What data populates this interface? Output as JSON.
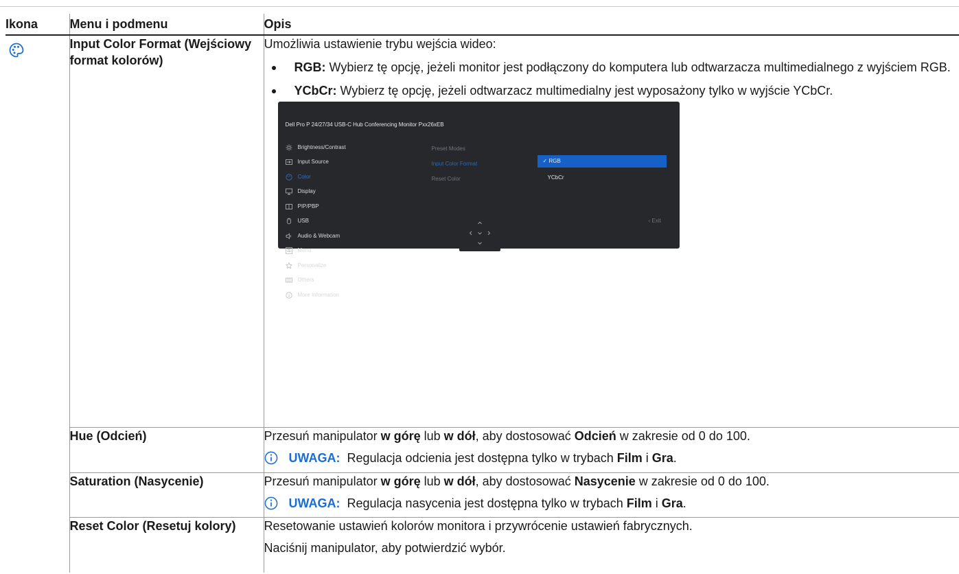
{
  "header": {
    "col_icon": "Ikona",
    "col_menu": "Menu i podmenu",
    "col_desc": "Opis"
  },
  "icon": "color-palette-icon",
  "rows": {
    "input_color": {
      "menu": "Input Color Format (Wejściowy format kolorów)",
      "intro": "Umożliwia ustawienie trybu wejścia wideo:",
      "bullet1_term": "RGB:",
      "bullet1_text": " Wybierz tę opcję, jeżeli monitor jest podłączony do komputera lub odtwarzacza multimedialnego z wyjściem RGB.",
      "bullet2_term": "YCbCr:",
      "bullet2_text": " Wybierz tę opcję, jeżeli odtwarzacz multimedialny jest wyposażony tylko w wyjście YCbCr."
    },
    "hue": {
      "menu": "Hue (Odcień)",
      "d1": "Przesuń manipulator ",
      "d2": "w górę",
      "d3": " lub ",
      "d4": "w dół",
      "d5": ", aby dostosować ",
      "d6": "Odcień",
      "d7": " w zakresie od 0 do 100.",
      "note_label": "UWAGA:",
      "note_text": " Regulacja odcienia jest dostępna tylko w trybach ",
      "note_b1": "Film",
      "note_mid": " i ",
      "note_b2": "Gra",
      "note_end": "."
    },
    "saturation": {
      "menu": "Saturation (Nasycenie)",
      "d1": "Przesuń manipulator ",
      "d2": "w górę",
      "d3": " lub ",
      "d4": "w dół",
      "d5": ", aby dostosować ",
      "d6": "Nasycenie",
      "d7": " w zakresie od 0 do 100.",
      "note_label": "UWAGA:",
      "note_text": " Regulacja nasycenia jest dostępna tylko w trybach ",
      "note_b1": "Film",
      "note_mid": " i ",
      "note_b2": "Gra",
      "note_end": "."
    },
    "reset": {
      "menu": "Reset Color (Resetuj kolory)",
      "d1": "Resetowanie ustawień kolorów monitora i przywrócenie ustawień fabrycznych.",
      "d2": "Naciśnij manipulator, aby potwierdzić wybór."
    }
  },
  "osd": {
    "title": "Dell Pro P 24/27/34 USB-C Hub Conferencing Monitor  Pxx26xEB",
    "menu_items": [
      {
        "label": "Brightness/Contrast",
        "icon": "sun-icon"
      },
      {
        "label": "Input Source",
        "icon": "input-icon"
      },
      {
        "label": "Color",
        "icon": "palette-icon"
      },
      {
        "label": "Display",
        "icon": "monitor-icon"
      },
      {
        "label": "PIP/PBP",
        "icon": "pip-icon"
      },
      {
        "label": "USB",
        "icon": "mouse-icon"
      },
      {
        "label": "Audio & Webcam",
        "icon": "speaker-icon"
      },
      {
        "label": "Menu",
        "icon": "menu-icon"
      },
      {
        "label": "Personalize",
        "icon": "star-icon"
      },
      {
        "label": "Others",
        "icon": "others-icon"
      },
      {
        "label": "More Information",
        "icon": "info-icon"
      }
    ],
    "submenu": [
      "Preset Modes",
      "Input Color Format",
      "Reset Color"
    ],
    "opt_rgb": "RGB",
    "opt_ycbcr": "YCbCr",
    "exit": "Exit"
  }
}
